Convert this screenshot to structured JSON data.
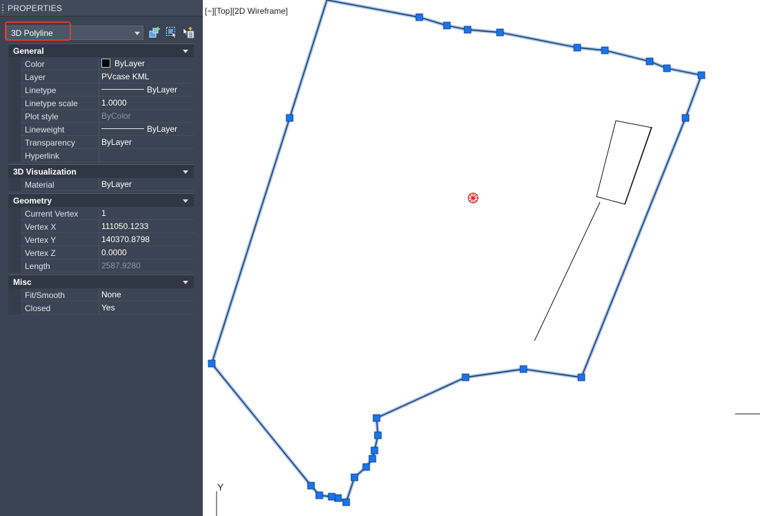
{
  "panel": {
    "title": "PROPERTIES",
    "object_type": "3D Polyline",
    "toolbar": [
      {
        "name": "quick-select-icon"
      },
      {
        "name": "select-objects-icon"
      },
      {
        "name": "toggle-pickadd-icon"
      }
    ]
  },
  "general": {
    "title": "General",
    "color": {
      "label": "Color",
      "value": "ByLayer"
    },
    "layer": {
      "label": "Layer",
      "value": "PVcase KML"
    },
    "linetype": {
      "label": "Linetype",
      "value": "ByLayer"
    },
    "linetype_scale": {
      "label": "Linetype scale",
      "value": "1.0000"
    },
    "plot_style": {
      "label": "Plot style",
      "value": "ByColor"
    },
    "lineweight": {
      "label": "Lineweight",
      "value": "ByLayer"
    },
    "transparency": {
      "label": "Transparency",
      "value": "ByLayer"
    },
    "hyperlink": {
      "label": "Hyperlink",
      "value": ""
    }
  },
  "visualization": {
    "title": "3D Visualization",
    "material": {
      "label": "Material",
      "value": "ByLayer"
    }
  },
  "geometry": {
    "title": "Geometry",
    "current_vertex": {
      "label": "Current Vertex",
      "value": "1"
    },
    "vertex_x": {
      "label": "Vertex X",
      "value": "111050.1233"
    },
    "vertex_y": {
      "label": "Vertex Y",
      "value": "140370.8798"
    },
    "vertex_z": {
      "label": "Vertex Z",
      "value": "0.0000"
    },
    "length": {
      "label": "Length",
      "value": "2587.9280"
    }
  },
  "misc": {
    "title": "Misc",
    "fit_smooth": {
      "label": "Fit/Smooth",
      "value": "None"
    },
    "closed": {
      "label": "Closed",
      "value": "Yes"
    }
  },
  "viewport": {
    "label": "[−][Top][2D Wireframe]",
    "ucs_axis_label": "Y"
  },
  "colors": {
    "panel_bg": "#3b4453",
    "highlight": "#e8372f",
    "grip": "#1a74e8",
    "selection_glow": "#9fc3f0",
    "center_marker": "#e01010"
  }
}
